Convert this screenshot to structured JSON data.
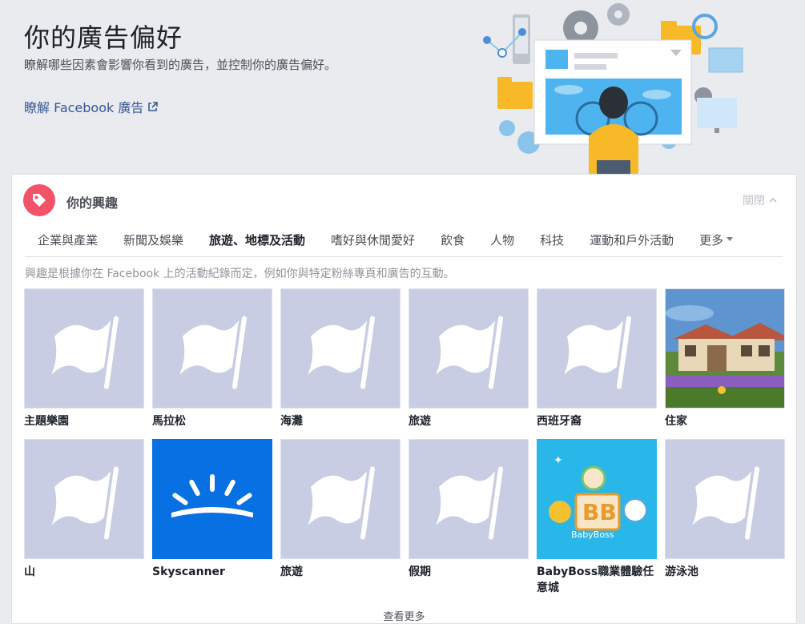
{
  "header": {
    "title": "你的廣告偏好",
    "subtitle": "瞭解哪些因素會影響你看到的廣告，並控制你的廣告偏好。",
    "learn_link": "瞭解 Facebook 廣告"
  },
  "interests": {
    "title": "你的興趣",
    "close_label": "關閉",
    "tabs": [
      "企業與產業",
      "新聞及娛樂",
      "旅遊、地標及活動",
      "嗜好與休閒愛好",
      "飲食",
      "人物",
      "科技",
      "運動和戶外活動"
    ],
    "active_tab": "旅遊、地標及活動",
    "more_label": "更多",
    "description": "興趣是根據你在 Facebook 上的活動紀錄而定，例如你與特定粉絲專頁和廣告的互動。",
    "items": [
      {
        "label": "主題樂園",
        "image": "flag-icon"
      },
      {
        "label": "馬拉松",
        "image": "flag-icon"
      },
      {
        "label": "海灘",
        "image": "flag-icon"
      },
      {
        "label": "旅遊",
        "image": "flag-icon"
      },
      {
        "label": "西班牙裔",
        "image": "flag-icon"
      },
      {
        "label": "住家",
        "image": "house-photo"
      },
      {
        "label": "山",
        "image": "flag-icon"
      },
      {
        "label": "Skyscanner",
        "image": "skyscanner-logo"
      },
      {
        "label": "旅遊",
        "image": "flag-icon"
      },
      {
        "label": "假期",
        "image": "flag-icon"
      },
      {
        "label": "BabyBoss職業體驗任意城",
        "image": "babyboss-logo"
      },
      {
        "label": "游泳池",
        "image": "flag-icon"
      }
    ],
    "see_more": "查看更多"
  },
  "colors": {
    "page_bg": "#e9ebee",
    "link": "#365899",
    "tag_badge": "#f35369",
    "placeholder_tile": "#c9cde3",
    "skyscanner_blue": "#0770e3",
    "babyboss_bg": "#29b6e8"
  }
}
